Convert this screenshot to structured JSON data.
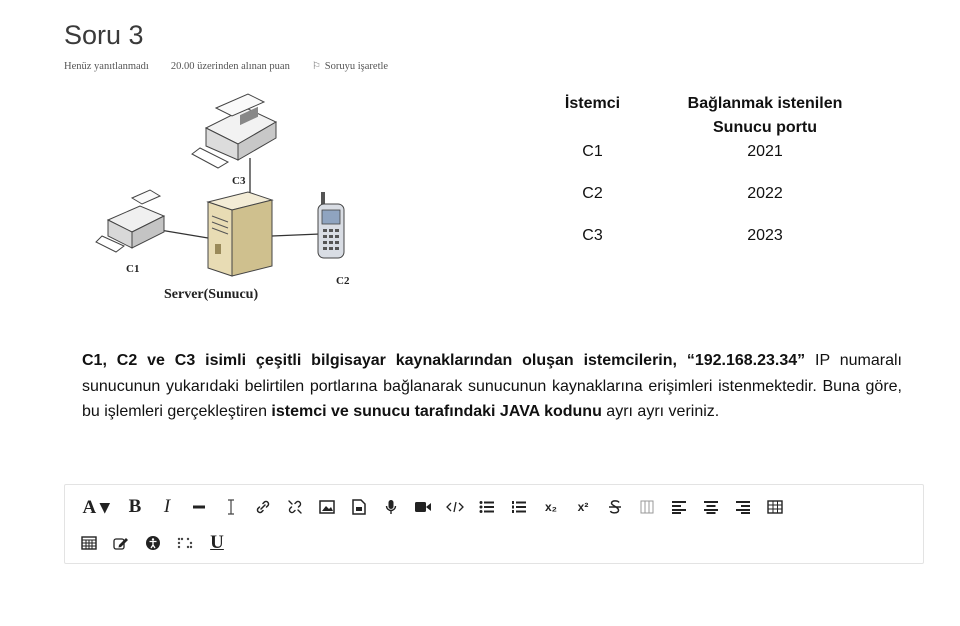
{
  "question": {
    "title": "Soru 3",
    "status": "Henüz yanıtlanmadı",
    "points": "20.00 üzerinden alınan puan",
    "flag_label": "Soruyu işaretle"
  },
  "diagram": {
    "server_label": "Server(Sunucu)",
    "client_labels": [
      "C1",
      "C2",
      "C3"
    ]
  },
  "port_table": {
    "header_client": "İstemci",
    "header_port_line1": "Bağlanmak istenilen",
    "header_port_line2": "Sunucu portu",
    "rows": [
      {
        "client": "C1",
        "port": "2021"
      },
      {
        "client": "C2",
        "port": "2022"
      },
      {
        "client": "C3",
        "port": "2023"
      }
    ]
  },
  "text": {
    "bold_intro": "C1, C2 ve C3 isimli çeşitli bilgisayar kaynaklarından oluşan istemcilerin, “192.168.23.34”",
    "part2": " IP numaralı sunucunun yukarıdaki belirtilen portlarına bağlanarak sunucunun kaynaklarına erişimleri istenmektedir. Buna göre, bu işlemleri gerçekleştiren ",
    "bold2": "istemci ve sunucu tarafındaki JAVA kodunu",
    "part3": " ayrı ayrı veriniz."
  },
  "editor": {
    "font_btn": "A ▾",
    "bold_btn": "B",
    "italic_btn": "I",
    "subscript_btn": "x₂",
    "superscript_btn": "x²",
    "underline_btn": "U"
  }
}
